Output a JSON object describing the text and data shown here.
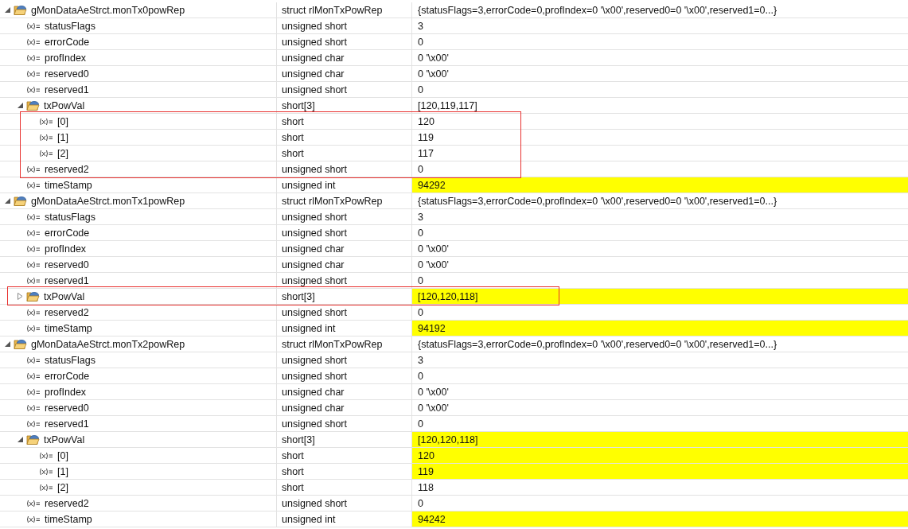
{
  "variables": [
    {
      "name": "gMonDataAeStrct.monTx0powRep",
      "type": "struct rlMonTxPowRep",
      "value": "{statusFlags=3,errorCode=0,profIndex=0 '\\x00',reserved0=0 '\\x00',reserved1=0...}",
      "kind": "struct",
      "expanded": true,
      "changed": false,
      "outlined": false,
      "children": [
        {
          "name": "statusFlags",
          "type": "unsigned short",
          "value": "3",
          "kind": "field",
          "changed": false,
          "outlined": false
        },
        {
          "name": "errorCode",
          "type": "unsigned short",
          "value": "0",
          "kind": "field",
          "changed": false,
          "outlined": false
        },
        {
          "name": "profIndex",
          "type": "unsigned char",
          "value": "0 '\\x00'",
          "kind": "field",
          "changed": false,
          "outlined": false
        },
        {
          "name": "reserved0",
          "type": "unsigned char",
          "value": "0 '\\x00'",
          "kind": "field",
          "changed": false,
          "outlined": false
        },
        {
          "name": "reserved1",
          "type": "unsigned short",
          "value": "0",
          "kind": "field",
          "changed": false,
          "outlined": false
        },
        {
          "name": "txPowVal",
          "type": "short[3]",
          "value": "[120,119,117]",
          "kind": "struct",
          "expanded": true,
          "changed": false,
          "outlined": false,
          "children": [
            {
              "name": "[0]",
              "type": "short",
              "value": "120",
              "kind": "field",
              "changed": false,
              "outlined": true
            },
            {
              "name": "[1]",
              "type": "short",
              "value": "119",
              "kind": "field",
              "changed": false,
              "outlined": true
            },
            {
              "name": "[2]",
              "type": "short",
              "value": "117",
              "kind": "field",
              "changed": false,
              "outlined": true
            }
          ]
        },
        {
          "name": "reserved2",
          "type": "unsigned short",
          "value": "0",
          "kind": "field",
          "changed": false,
          "outlined": true
        },
        {
          "name": "timeStamp",
          "type": "unsigned int",
          "value": "94292",
          "kind": "field",
          "changed": true,
          "outlined": false
        }
      ]
    },
    {
      "name": "gMonDataAeStrct.monTx1powRep",
      "type": "struct rlMonTxPowRep",
      "value": "{statusFlags=3,errorCode=0,profIndex=0 '\\x00',reserved0=0 '\\x00',reserved1=0...}",
      "kind": "struct",
      "expanded": true,
      "changed": false,
      "outlined": false,
      "children": [
        {
          "name": "statusFlags",
          "type": "unsigned short",
          "value": "3",
          "kind": "field",
          "changed": false,
          "outlined": false
        },
        {
          "name": "errorCode",
          "type": "unsigned short",
          "value": "0",
          "kind": "field",
          "changed": false,
          "outlined": false
        },
        {
          "name": "profIndex",
          "type": "unsigned char",
          "value": "0 '\\x00'",
          "kind": "field",
          "changed": false,
          "outlined": false
        },
        {
          "name": "reserved0",
          "type": "unsigned char",
          "value": "0 '\\x00'",
          "kind": "field",
          "changed": false,
          "outlined": false
        },
        {
          "name": "reserved1",
          "type": "unsigned short",
          "value": "0",
          "kind": "field",
          "changed": false,
          "outlined": false
        },
        {
          "name": "txPowVal",
          "type": "short[3]",
          "value": "[120,120,118]",
          "kind": "struct",
          "expanded": false,
          "changed": true,
          "outlined": true
        },
        {
          "name": "reserved2",
          "type": "unsigned short",
          "value": "0",
          "kind": "field",
          "changed": false,
          "outlined": false
        },
        {
          "name": "timeStamp",
          "type": "unsigned int",
          "value": "94192",
          "kind": "field",
          "changed": true,
          "outlined": false
        }
      ]
    },
    {
      "name": "gMonDataAeStrct.monTx2powRep",
      "type": "struct rlMonTxPowRep",
      "value": "{statusFlags=3,errorCode=0,profIndex=0 '\\x00',reserved0=0 '\\x00',reserved1=0...}",
      "kind": "struct",
      "expanded": true,
      "changed": false,
      "outlined": false,
      "children": [
        {
          "name": "statusFlags",
          "type": "unsigned short",
          "value": "3",
          "kind": "field",
          "changed": false,
          "outlined": false
        },
        {
          "name": "errorCode",
          "type": "unsigned short",
          "value": "0",
          "kind": "field",
          "changed": false,
          "outlined": false
        },
        {
          "name": "profIndex",
          "type": "unsigned char",
          "value": "0 '\\x00'",
          "kind": "field",
          "changed": false,
          "outlined": false
        },
        {
          "name": "reserved0",
          "type": "unsigned char",
          "value": "0 '\\x00'",
          "kind": "field",
          "changed": false,
          "outlined": false
        },
        {
          "name": "reserved1",
          "type": "unsigned short",
          "value": "0",
          "kind": "field",
          "changed": false,
          "outlined": false
        },
        {
          "name": "txPowVal",
          "type": "short[3]",
          "value": "[120,120,118]",
          "kind": "struct",
          "expanded": true,
          "changed": true,
          "outlined": false,
          "children": [
            {
              "name": "[0]",
              "type": "short",
              "value": "120",
              "kind": "field",
              "changed": true,
              "outlined": false
            },
            {
              "name": "[1]",
              "type": "short",
              "value": "119",
              "kind": "field",
              "changed": true,
              "outlined": false
            },
            {
              "name": "[2]",
              "type": "short",
              "value": "118",
              "kind": "field",
              "changed": false,
              "outlined": false
            }
          ]
        },
        {
          "name": "reserved2",
          "type": "unsigned short",
          "value": "0",
          "kind": "field",
          "changed": false,
          "outlined": false
        },
        {
          "name": "timeStamp",
          "type": "unsigned int",
          "value": "94242",
          "kind": "field",
          "changed": true,
          "outlined": false
        }
      ]
    }
  ]
}
